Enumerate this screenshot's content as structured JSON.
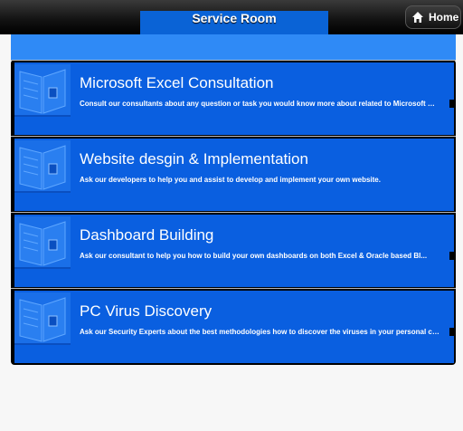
{
  "header": {
    "title": "Service Room",
    "home_label": "Home"
  },
  "list": {
    "items": [
      {
        "title": "Microsoft Excel Consultation",
        "desc": "Consult our consultants about any question or task you would know more about related to Microsoft Excel..."
      },
      {
        "title": "Website desgin & Implementation",
        "desc": "Ask our developers to help you and assist to develop and implement your own website."
      },
      {
        "title": "Dashboard Building",
        "desc": "Ask our consultant to help you how to build your own dashboards on both Excel & Oracle based BI..."
      },
      {
        "title": "PC Virus Discovery",
        "desc": "Ask our Security Experts about the best methodologies how to discover the viruses in your personal computer..."
      }
    ]
  },
  "colors": {
    "accent": "#0a5fe0",
    "subbar": "#2f8af6",
    "header": "#000000"
  },
  "icons": {
    "home": "home-icon",
    "item_thumb": "book-icon"
  }
}
